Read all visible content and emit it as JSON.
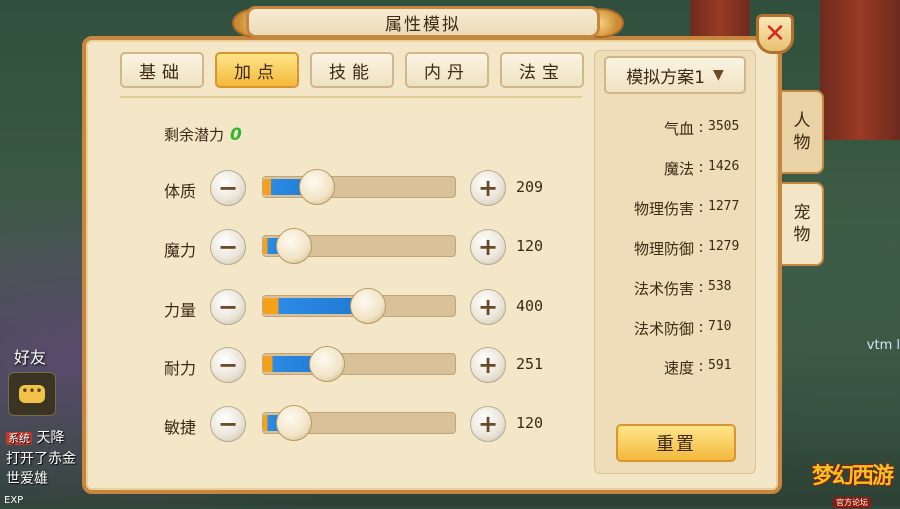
{
  "dialog": {
    "title": "属性模拟"
  },
  "tabs": [
    {
      "label": "基础",
      "active": false
    },
    {
      "label": "加点",
      "active": true
    },
    {
      "label": "技能",
      "active": false
    },
    {
      "label": "内丹",
      "active": false
    },
    {
      "label": "法宝",
      "active": false
    }
  ],
  "points": {
    "label": "剩余潜力",
    "value": "0"
  },
  "attributes": [
    {
      "label": "体质",
      "value": "209",
      "level": 0.28
    },
    {
      "label": "魔力",
      "value": "120",
      "level": 0.16
    },
    {
      "label": "力量",
      "value": "400",
      "level": 0.54
    },
    {
      "label": "耐力",
      "value": "251",
      "level": 0.33
    },
    {
      "label": "敏捷",
      "value": "120",
      "level": 0.16
    }
  ],
  "plan": {
    "selected": "模拟方案1"
  },
  "stats": [
    {
      "label": "气血",
      "value": "3505"
    },
    {
      "label": "魔法",
      "value": "1426"
    },
    {
      "label": "物理伤害",
      "value": "1277"
    },
    {
      "label": "物理防御",
      "value": "1279"
    },
    {
      "label": "法术伤害",
      "value": "538"
    },
    {
      "label": "法术防御",
      "value": "710"
    },
    {
      "label": "速度",
      "value": "591"
    }
  ],
  "reset_label": "重置",
  "side_tabs": [
    {
      "label": "人物",
      "active": false
    },
    {
      "label": "宠物",
      "active": true
    }
  ],
  "background": {
    "friend_label": "好友",
    "chat_badge": "系统",
    "chat_line1": "天降",
    "chat_line2": "打开了赤金",
    "chat_line3": "世爱雄",
    "exp_label": "EXP",
    "right_name": "vtm l",
    "logo_text": "梦幻西游",
    "logo_sub": "官方论坛"
  },
  "colors": {
    "accent": "#f3b93c",
    "frame": "#c7863f",
    "close": "#d62b1e",
    "remain": "#2eb82e"
  }
}
